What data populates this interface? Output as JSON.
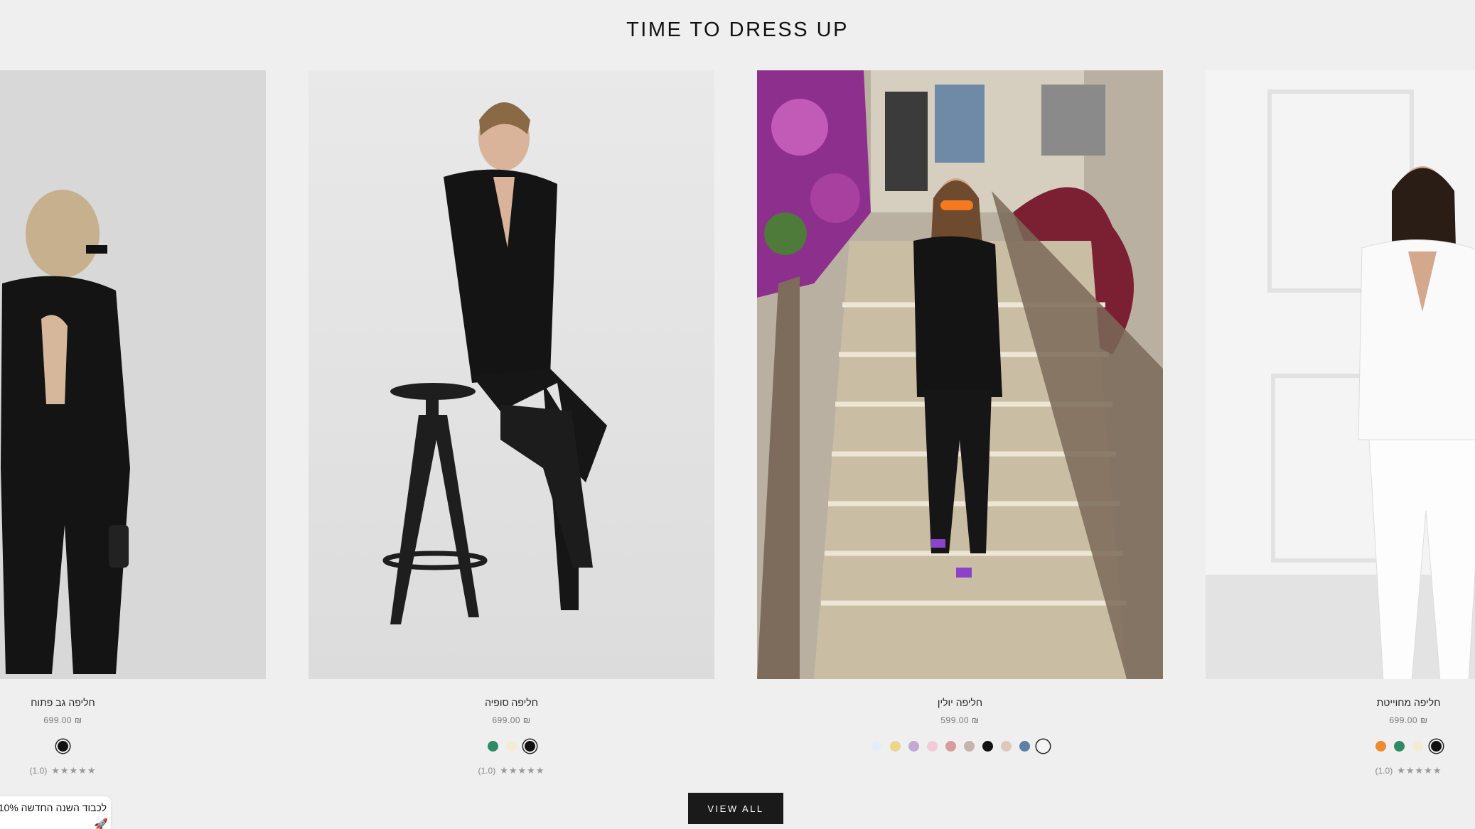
{
  "section": {
    "title": "TIME TO DRESS UP"
  },
  "products": [
    {
      "name": "חליפה גב פתוח",
      "price": "₪ 699.00",
      "swatches": [
        {
          "color": "#111111",
          "selected": true
        }
      ],
      "rating": {
        "value": "(1.0)",
        "stars": "★★★★★"
      },
      "image": "woman-black-suit-open-back"
    },
    {
      "name": "חליפה סופיה",
      "price": "₪ 699.00",
      "swatches": [
        {
          "color": "#2e8b67",
          "selected": false
        },
        {
          "color": "#f3ecd4",
          "selected": false
        },
        {
          "color": "#111111",
          "selected": true
        }
      ],
      "rating": {
        "value": "(1.0)",
        "stars": "★★★★★"
      },
      "image": "woman-black-suit-stool"
    },
    {
      "name": "חליפה יולין",
      "price": "₪ 599.00",
      "swatches": [
        {
          "color": "#e4eef8",
          "selected": false
        },
        {
          "color": "#ecd68c",
          "selected": false
        },
        {
          "color": "#c1a9d2",
          "selected": false
        },
        {
          "color": "#f5cad8",
          "selected": false
        },
        {
          "color": "#d89c9c",
          "selected": false
        },
        {
          "color": "#c7b2ae",
          "selected": false
        },
        {
          "color": "#111111",
          "selected": false
        },
        {
          "color": "#ddc8bb",
          "selected": false
        },
        {
          "color": "#5f7fa8",
          "selected": false
        },
        {
          "color": "#f4f4f4",
          "selected": true
        }
      ],
      "rating": null,
      "image": "woman-black-suit-stairs"
    },
    {
      "name": "חליפה מחוייטת",
      "price": "₪ 699.00",
      "swatches": [
        {
          "color": "#ee8b2e",
          "selected": false
        },
        {
          "color": "#2e8b67",
          "selected": false
        },
        {
          "color": "#f3ecd4",
          "selected": false
        },
        {
          "color": "#111111",
          "selected": true
        }
      ],
      "rating": {
        "value": "(1.0)",
        "stars": "★★★★★"
      },
      "image": "woman-white-suit"
    }
  ],
  "view_all": "VIEW ALL",
  "promo": {
    "text": "לכבוד השנה החדשה 10%",
    "icon": "rocket-icon"
  }
}
